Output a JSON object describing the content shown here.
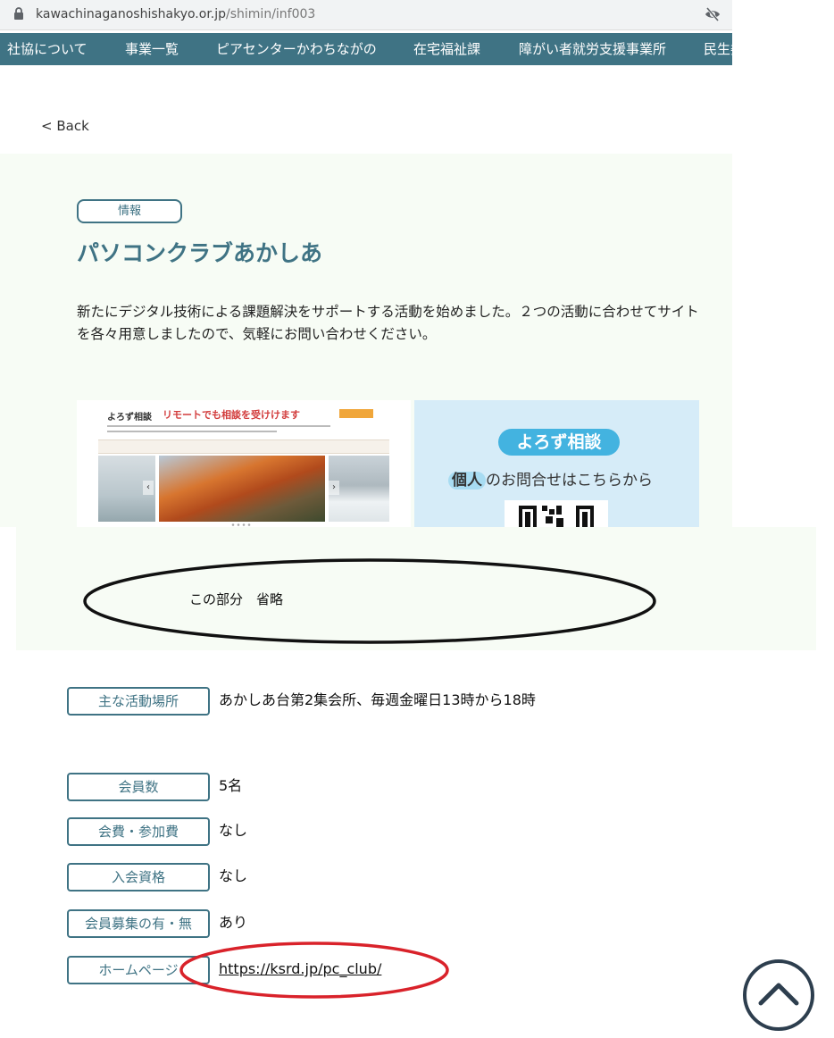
{
  "browser": {
    "url_host": "kawachinaganoshishakyo.or.jp",
    "url_path": "/shimin/inf003"
  },
  "nav": {
    "items": [
      "社協について",
      "事業一覧",
      "ピアセンターかわちながの",
      "在宅福祉課",
      "障がい者就労支援事業所",
      "民生委"
    ]
  },
  "back_label": "< Back",
  "article": {
    "tag": "情報",
    "title": "パソコンクラブあかしあ",
    "description": "新たにデジタル技術による課題解決をサポートする活動を始めました。２つの活動に合わせてサイトを各々用意しましたので、気軽にお問い合わせください。"
  },
  "banner_left": {
    "brand": "よろず相談",
    "headline": "リモートでも相談を受けけます"
  },
  "banner_right": {
    "pill": "よろず相談",
    "highlight": "個人",
    "text": "のお問合せはこちらから"
  },
  "annotation": {
    "omitted": "この部分　省略"
  },
  "info": [
    {
      "label": "主な活動場所",
      "value": "あかしあ台第2集会所、毎週金曜日13時から18時"
    },
    {
      "label": "会員数",
      "value": "5名"
    },
    {
      "label": "会費・参加費",
      "value": "なし"
    },
    {
      "label": "入会資格",
      "value": "なし"
    },
    {
      "label": "会員募集の有・無",
      "value": "あり"
    },
    {
      "label": "ホームページ",
      "value": "https://ksrd.jp/pc_club/"
    }
  ],
  "colors": {
    "brand": "#3f7384",
    "panel_bg": "#f7fcf5",
    "annotation_red": "#d9222a",
    "banner_blue": "#43b3e0"
  }
}
